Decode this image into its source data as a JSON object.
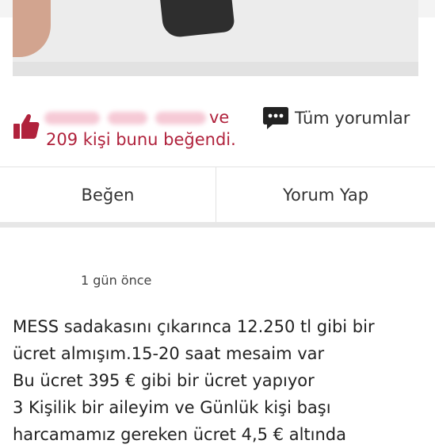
{
  "post": {
    "liked_by_conjunction": "ve",
    "liked_by_summary": "209 kişi bunu beğendi.",
    "all_comments_label": "Tüm yorumlar"
  },
  "actions": {
    "like_label": "Beğen",
    "comment_label": "Yorum Yap"
  },
  "next_post": {
    "timestamp": "1 gün önce",
    "lines": [
      "MESS sadakasını çıkarınca 12.250 tl gibi bir",
      "ücret almışım.15-20 saat mesaim var",
      "Bu ücret 395 € gibi bir ücret yapıyor",
      "3 Kişilik bir aileyim ve Günlük kişi başı",
      "harcamamız gereken ücret 4,5 € altında"
    ]
  },
  "colors": {
    "accent": "#b0223c",
    "text": "#222222",
    "divider": "#e3e3e3"
  },
  "icons": [
    "thumbs-up-icon",
    "comment-bubble-icon"
  ]
}
